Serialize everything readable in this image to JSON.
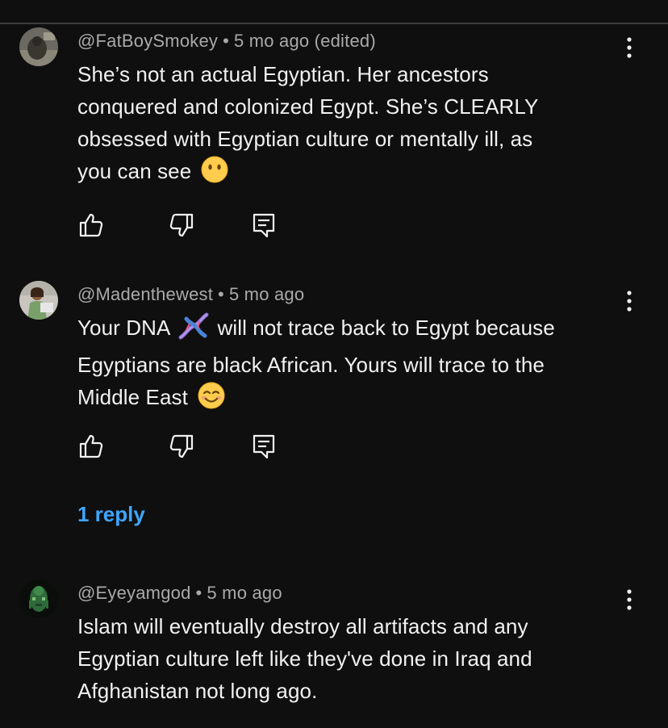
{
  "comments": [
    {
      "author": "@FatBoySmokey",
      "separator": "•",
      "time": "5 mo ago (edited)",
      "lines": [
        "She’s not an actual Egyptian. Her ancestors",
        "conquered and colonized Egypt. She’s CLEARLY",
        "obsessed with Egyptian culture or mentally ill, as",
        "you can see"
      ],
      "emoji_icon": "face-without-mouth-emoji"
    },
    {
      "author": "@Madenthewest",
      "separator": "•",
      "time": "5 mo ago",
      "line1_before": "Your DNA",
      "line1_after": "will not trace back to Egypt because",
      "lines_rest": [
        "Egyptians are black African. Yours will trace to the"
      ],
      "line_last": "Middle East",
      "inline_icons": [
        "dna-emoji",
        "smiling-face-emoji"
      ],
      "replies_label": "1 reply"
    },
    {
      "author": "@Eyeyamgod",
      "separator": "•",
      "time": "5 mo ago",
      "lines": [
        "Islam will eventually destroy all artifacts and any",
        "Egyptian culture left like they've done in Iraq and",
        "Afghanistan not long ago."
      ]
    }
  ],
  "icons": {
    "like": "thumbs-up-icon",
    "dislike": "thumbs-down-icon",
    "reply": "reply-comment-icon",
    "more": "more-vertical-icon"
  },
  "colors": {
    "background": "#0f0f0f",
    "text": "#f1f1f1",
    "meta": "#aaaaaa",
    "link": "#3ea6ff"
  }
}
